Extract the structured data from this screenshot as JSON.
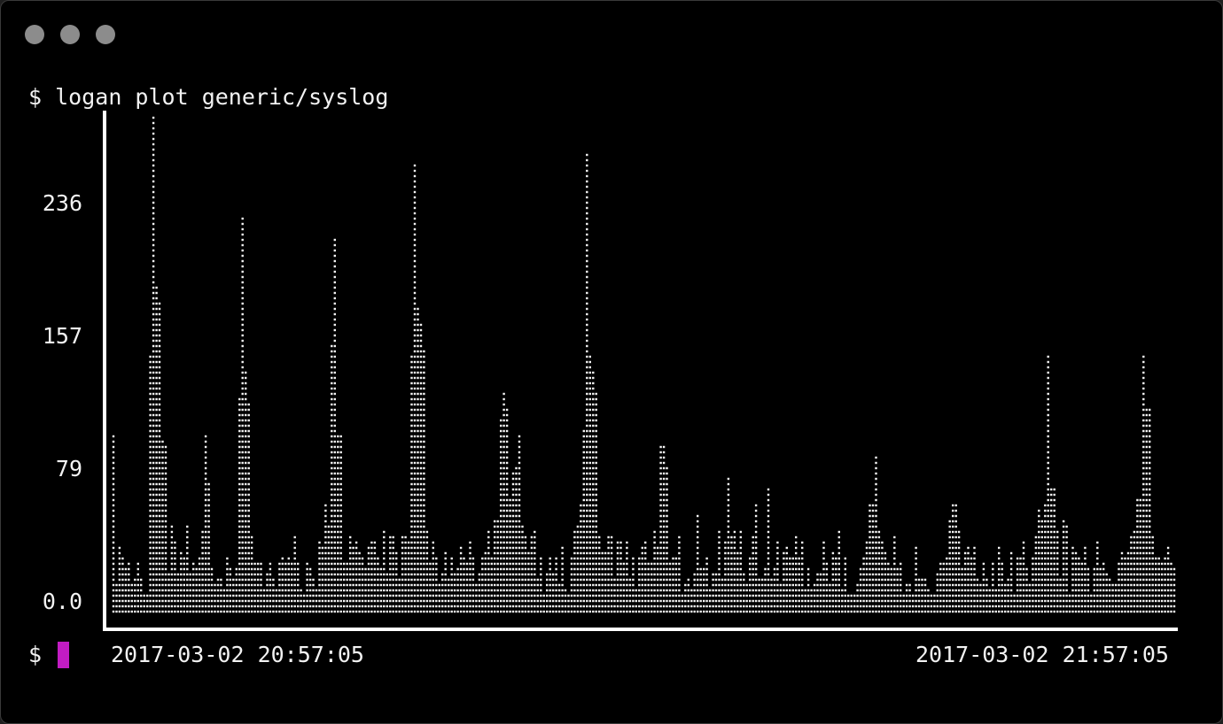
{
  "window": {
    "controls": [
      "close",
      "minimize",
      "zoom"
    ]
  },
  "terminal": {
    "prompt": "$",
    "command": "logan plot generic/syslog",
    "second_prompt": "$"
  },
  "chart_data": {
    "type": "bar",
    "style": "braille-dot terminal plot",
    "x_tick_labels": [
      "2017-03-02 20:57:05",
      "2017-03-02 21:57:05"
    ],
    "y_tick_labels": [
      "236",
      "157",
      "79",
      "0.0"
    ],
    "y_ticks": [
      236,
      157,
      79,
      0
    ],
    "ylim": [
      0,
      289
    ],
    "values": [
      105,
      18,
      38,
      33,
      26,
      30,
      18,
      19,
      30,
      21,
      10,
      12,
      151,
      289,
      190,
      180,
      100,
      96,
      24,
      50,
      41,
      22,
      37,
      32,
      50,
      22,
      30,
      26,
      33,
      49,
      104,
      76,
      27,
      16,
      21,
      19,
      15,
      34,
      27,
      20,
      25,
      124,
      232,
      141,
      121,
      45,
      28,
      28,
      29,
      14,
      23,
      29,
      21,
      14,
      29,
      31,
      28,
      33,
      30,
      45,
      30,
      14,
      12,
      30,
      25,
      21,
      15,
      41,
      39,
      63,
      51,
      155,
      218,
      104,
      103,
      29,
      30,
      44,
      38,
      42,
      35,
      34,
      25,
      39,
      42,
      41,
      31,
      25,
      49,
      24,
      44,
      46,
      36,
      20,
      44,
      45,
      42,
      150,
      262,
      178,
      170,
      153,
      47,
      29,
      41,
      32,
      17,
      23,
      37,
      19,
      33,
      22,
      25,
      38,
      34,
      28,
      43,
      31,
      16,
      23,
      32,
      37,
      49,
      34,
      54,
      54,
      114,
      127,
      120,
      66,
      83,
      84,
      104,
      52,
      44,
      37,
      46,
      47,
      21,
      31,
      11,
      24,
      31,
      23,
      32,
      16,
      38,
      14,
      12,
      32,
      48,
      51,
      63,
      107,
      267,
      150,
      140,
      127,
      46,
      36,
      35,
      44,
      44,
      21,
      41,
      41,
      28,
      42,
      19,
      32,
      14,
      31,
      38,
      43,
      29,
      30,
      48,
      40,
      99,
      96,
      84,
      30,
      31,
      32,
      46,
      12,
      17,
      20,
      14,
      23,
      57,
      27,
      25,
      32,
      14,
      24,
      22,
      47,
      21,
      42,
      78,
      46,
      47,
      35,
      49,
      22,
      16,
      31,
      44,
      62,
      20,
      21,
      25,
      73,
      19,
      26,
      42,
      17,
      36,
      39,
      34,
      34,
      45,
      31,
      43,
      15,
      25,
      14,
      18,
      24,
      22,
      41,
      28,
      18,
      35,
      32,
      47,
      14,
      32,
      11,
      10,
      12,
      17,
      25,
      33,
      43,
      62,
      63,
      92,
      48,
      41,
      35,
      29,
      25,
      44,
      25,
      29,
      12,
      17,
      17,
      12,
      38,
      20,
      20,
      19,
      14,
      12,
      12,
      22,
      29,
      28,
      31,
      53,
      63,
      63,
      48,
      25,
      37,
      38,
      34,
      40,
      21,
      16,
      30,
      21,
      13,
      29,
      14,
      38,
      28,
      17,
      21,
      35,
      12,
      32,
      33,
      43,
      25,
      18,
      31,
      45,
      60,
      55,
      63,
      149,
      72,
      74,
      48,
      20,
      54,
      50,
      12,
      40,
      35,
      33,
      28,
      38,
      25,
      12,
      26,
      41,
      26,
      30,
      24,
      21,
      16,
      17,
      28,
      37,
      31,
      37,
      44,
      49,
      68,
      68,
      150,
      119,
      119,
      46,
      34,
      34,
      30,
      32,
      38,
      29,
      26
    ]
  }
}
